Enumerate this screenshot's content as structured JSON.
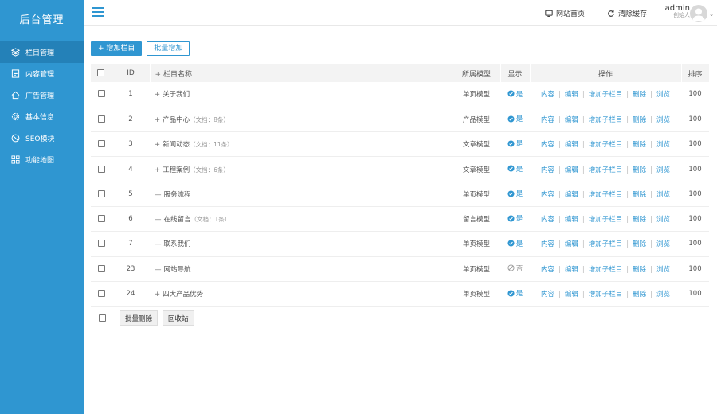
{
  "sidebar": {
    "brand": "后台管理",
    "items": [
      {
        "label": "栏目管理",
        "icon": "layers-icon",
        "active": true
      },
      {
        "label": "内容管理",
        "icon": "document-icon",
        "active": false
      },
      {
        "label": "广告管理",
        "icon": "home-icon",
        "active": false
      },
      {
        "label": "基本信息",
        "icon": "gear-icon",
        "active": false
      },
      {
        "label": "SEO模块",
        "icon": "compass-icon",
        "active": false
      },
      {
        "label": "功能地图",
        "icon": "grid-icon",
        "active": false
      }
    ]
  },
  "topbar": {
    "site_home": "网站首页",
    "clear_cache": "清除缓存",
    "user_name": "admin",
    "user_role": "创始人"
  },
  "actions": {
    "add_column": "+ 增加栏目",
    "batch_add": "批量增加"
  },
  "table": {
    "headers": {
      "id": "ID",
      "name": "栏目名称",
      "model": "所属模型",
      "display": "显示",
      "ops": "操作",
      "sort": "排序"
    },
    "op_labels": {
      "content": "内容",
      "edit": "编辑",
      "add_sub": "增加子栏目",
      "delete": "删除",
      "browse": "浏览"
    },
    "rows": [
      {
        "id": "1",
        "sign": "+",
        "name": "关于我们",
        "count": "",
        "model": "单页模型",
        "display": "是",
        "visible": true,
        "sort": "100"
      },
      {
        "id": "2",
        "sign": "+",
        "name": "产品中心",
        "count": "（文档：8条）",
        "model": "产品模型",
        "display": "是",
        "visible": true,
        "sort": "100"
      },
      {
        "id": "3",
        "sign": "+",
        "name": "新闻动态",
        "count": "（文档：11条）",
        "model": "文章模型",
        "display": "是",
        "visible": true,
        "sort": "100"
      },
      {
        "id": "4",
        "sign": "+",
        "name": "工程案例",
        "count": "（文档：6条）",
        "model": "文章模型",
        "display": "是",
        "visible": true,
        "sort": "100"
      },
      {
        "id": "5",
        "sign": "—",
        "name": "服务流程",
        "count": "",
        "model": "单页模型",
        "display": "是",
        "visible": true,
        "sort": "100"
      },
      {
        "id": "6",
        "sign": "—",
        "name": "在线留言",
        "count": "（文档：1条）",
        "model": "留言模型",
        "display": "是",
        "visible": true,
        "sort": "100"
      },
      {
        "id": "7",
        "sign": "—",
        "name": "联系我们",
        "count": "",
        "model": "单页模型",
        "display": "是",
        "visible": true,
        "sort": "100"
      },
      {
        "id": "23",
        "sign": "—",
        "name": "网站导航",
        "count": "",
        "model": "单页模型",
        "display": "否",
        "visible": false,
        "sort": "100"
      },
      {
        "id": "24",
        "sign": "+",
        "name": "四大产品优势",
        "count": "",
        "model": "单页模型",
        "display": "是",
        "visible": true,
        "sort": "100"
      }
    ]
  },
  "footer": {
    "batch_delete": "批量删除",
    "recycle_bin": "回收站"
  },
  "colors": {
    "sidebar_bg": "#2f96d1",
    "sidebar_active": "#2481b8",
    "link": "#2f96d1"
  }
}
